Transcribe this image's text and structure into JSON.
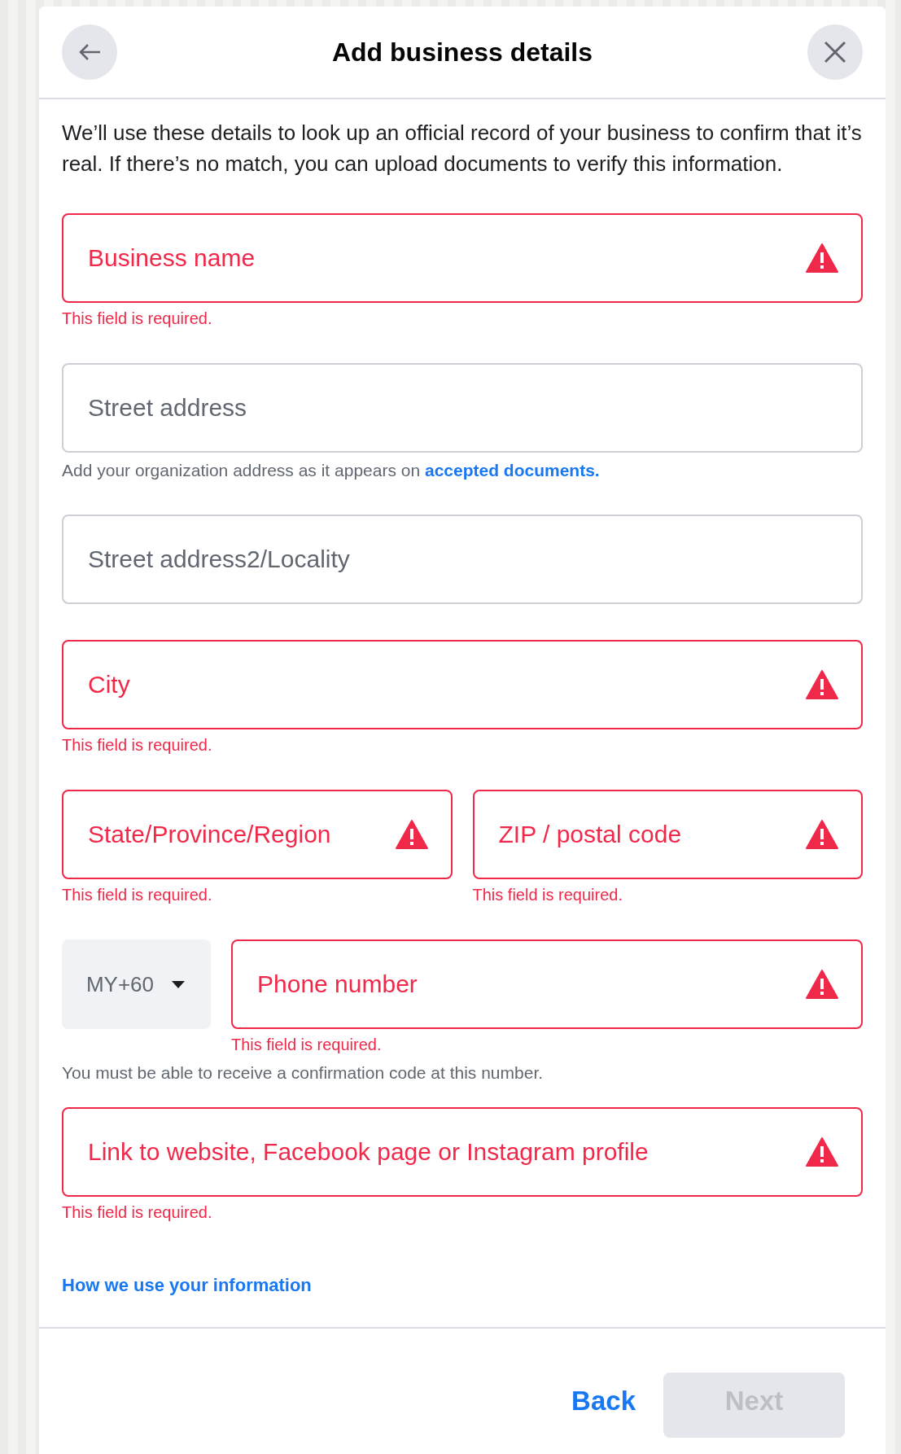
{
  "dialog": {
    "title": "Add business details",
    "intro": "We’ll use these details to look up an official record of your business to confirm that it’s real. If there’s no match, you can upload documents to verify this information.",
    "fields": [
      {
        "kind": "single",
        "placeholder": "Business name",
        "error": true,
        "error_text": "This field is required."
      },
      {
        "kind": "single",
        "placeholder": "Street address",
        "error": false,
        "helper": {
          "text": "Add your organization address as it appears on ",
          "link": "accepted documents."
        }
      },
      {
        "kind": "single",
        "placeholder": "Street address2/Locality",
        "error": false
      },
      {
        "kind": "single",
        "placeholder": "City",
        "error": true,
        "error_text": "This field is required."
      },
      {
        "kind": "pair",
        "fields": [
          {
            "placeholder": "State/Province/Region",
            "error": true,
            "error_text": "This field is required."
          },
          {
            "placeholder": "ZIP / postal code",
            "error": true,
            "error_text": "This field is required."
          }
        ]
      },
      {
        "kind": "phone",
        "country_code": "MY+60",
        "field": {
          "placeholder": "Phone number",
          "error": true,
          "error_text": "This field is required."
        },
        "helper": {
          "text": "You must be able to receive a confirmation code at this number."
        }
      },
      {
        "kind": "single",
        "placeholder": "Link to website, Facebook page or Instagram profile",
        "error": true,
        "error_text": "This field is required."
      }
    ],
    "info_link": "How we use your information",
    "footer": {
      "back": "Back",
      "next": "Next",
      "next_disabled": true
    }
  }
}
